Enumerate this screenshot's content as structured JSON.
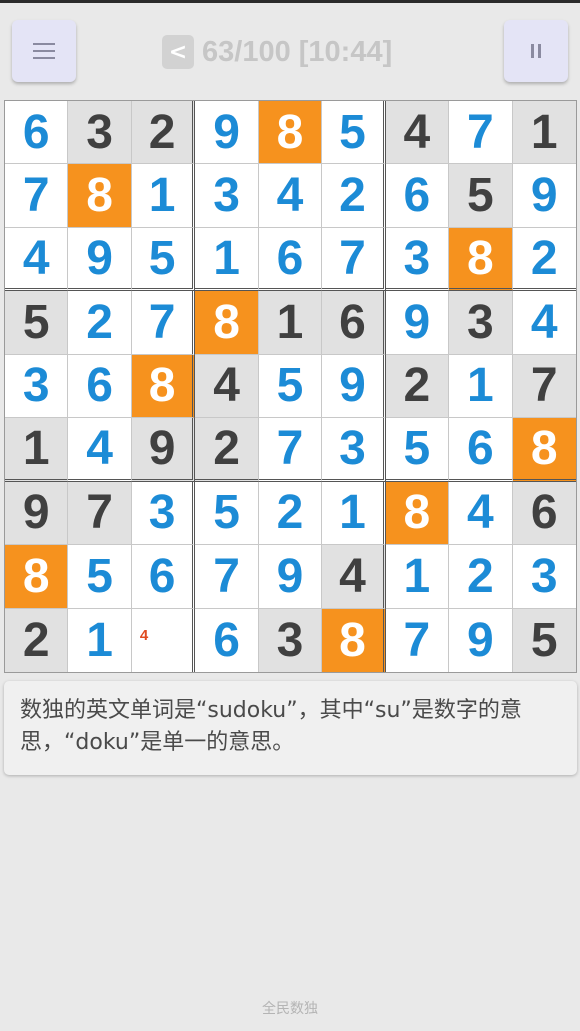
{
  "header": {
    "back_label": "<",
    "status": "63/100 [10:44]"
  },
  "board": {
    "cells": [
      [
        {
          "v": "6",
          "t": "user"
        },
        {
          "v": "3",
          "t": "given"
        },
        {
          "v": "2",
          "t": "given"
        },
        {
          "v": "9",
          "t": "user"
        },
        {
          "v": "8",
          "t": "hl"
        },
        {
          "v": "5",
          "t": "user"
        },
        {
          "v": "4",
          "t": "given"
        },
        {
          "v": "7",
          "t": "user"
        },
        {
          "v": "1",
          "t": "given"
        }
      ],
      [
        {
          "v": "7",
          "t": "user"
        },
        {
          "v": "8",
          "t": "hl"
        },
        {
          "v": "1",
          "t": "user"
        },
        {
          "v": "3",
          "t": "user"
        },
        {
          "v": "4",
          "t": "user"
        },
        {
          "v": "2",
          "t": "user"
        },
        {
          "v": "6",
          "t": "user"
        },
        {
          "v": "5",
          "t": "given"
        },
        {
          "v": "9",
          "t": "user"
        }
      ],
      [
        {
          "v": "4",
          "t": "user"
        },
        {
          "v": "9",
          "t": "user"
        },
        {
          "v": "5",
          "t": "user"
        },
        {
          "v": "1",
          "t": "user"
        },
        {
          "v": "6",
          "t": "user"
        },
        {
          "v": "7",
          "t": "user"
        },
        {
          "v": "3",
          "t": "user"
        },
        {
          "v": "8",
          "t": "hl"
        },
        {
          "v": "2",
          "t": "user"
        }
      ],
      [
        {
          "v": "5",
          "t": "given"
        },
        {
          "v": "2",
          "t": "user"
        },
        {
          "v": "7",
          "t": "user"
        },
        {
          "v": "8",
          "t": "hl"
        },
        {
          "v": "1",
          "t": "given"
        },
        {
          "v": "6",
          "t": "given"
        },
        {
          "v": "9",
          "t": "user"
        },
        {
          "v": "3",
          "t": "given"
        },
        {
          "v": "4",
          "t": "user"
        }
      ],
      [
        {
          "v": "3",
          "t": "user"
        },
        {
          "v": "6",
          "t": "user"
        },
        {
          "v": "8",
          "t": "hl"
        },
        {
          "v": "4",
          "t": "given"
        },
        {
          "v": "5",
          "t": "user"
        },
        {
          "v": "9",
          "t": "user"
        },
        {
          "v": "2",
          "t": "given"
        },
        {
          "v": "1",
          "t": "user"
        },
        {
          "v": "7",
          "t": "given"
        }
      ],
      [
        {
          "v": "1",
          "t": "given"
        },
        {
          "v": "4",
          "t": "user"
        },
        {
          "v": "9",
          "t": "given"
        },
        {
          "v": "2",
          "t": "given"
        },
        {
          "v": "7",
          "t": "user"
        },
        {
          "v": "3",
          "t": "user"
        },
        {
          "v": "5",
          "t": "user"
        },
        {
          "v": "6",
          "t": "user"
        },
        {
          "v": "8",
          "t": "hl"
        }
      ],
      [
        {
          "v": "9",
          "t": "given"
        },
        {
          "v": "7",
          "t": "given"
        },
        {
          "v": "3",
          "t": "user"
        },
        {
          "v": "5",
          "t": "user"
        },
        {
          "v": "2",
          "t": "user"
        },
        {
          "v": "1",
          "t": "user"
        },
        {
          "v": "8",
          "t": "hl"
        },
        {
          "v": "4",
          "t": "user"
        },
        {
          "v": "6",
          "t": "given"
        }
      ],
      [
        {
          "v": "8",
          "t": "hl"
        },
        {
          "v": "5",
          "t": "user"
        },
        {
          "v": "6",
          "t": "user"
        },
        {
          "v": "7",
          "t": "user"
        },
        {
          "v": "9",
          "t": "user"
        },
        {
          "v": "4",
          "t": "given"
        },
        {
          "v": "1",
          "t": "user"
        },
        {
          "v": "2",
          "t": "user"
        },
        {
          "v": "3",
          "t": "user"
        }
      ],
      [
        {
          "v": "2",
          "t": "given"
        },
        {
          "v": "1",
          "t": "user"
        },
        {
          "v": "",
          "t": "empty",
          "note": "4"
        },
        {
          "v": "6",
          "t": "user"
        },
        {
          "v": "3",
          "t": "given"
        },
        {
          "v": "8",
          "t": "hl"
        },
        {
          "v": "7",
          "t": "user"
        },
        {
          "v": "9",
          "t": "user"
        },
        {
          "v": "5",
          "t": "given"
        }
      ]
    ]
  },
  "tip": {
    "text": "数独的英文单词是“sudoku”，其中“su”是数字的意思，“doku”是单一的意思。"
  },
  "footer": {
    "app_name": "全民数独"
  },
  "colors": {
    "accent": "#f6921e",
    "user_digit": "#1c8bd6",
    "given_digit": "#404040",
    "given_bg": "#e1e1e1",
    "note": "#e04b1f"
  },
  "icons": {
    "menu": "menu-icon",
    "pause": "pause-icon"
  }
}
